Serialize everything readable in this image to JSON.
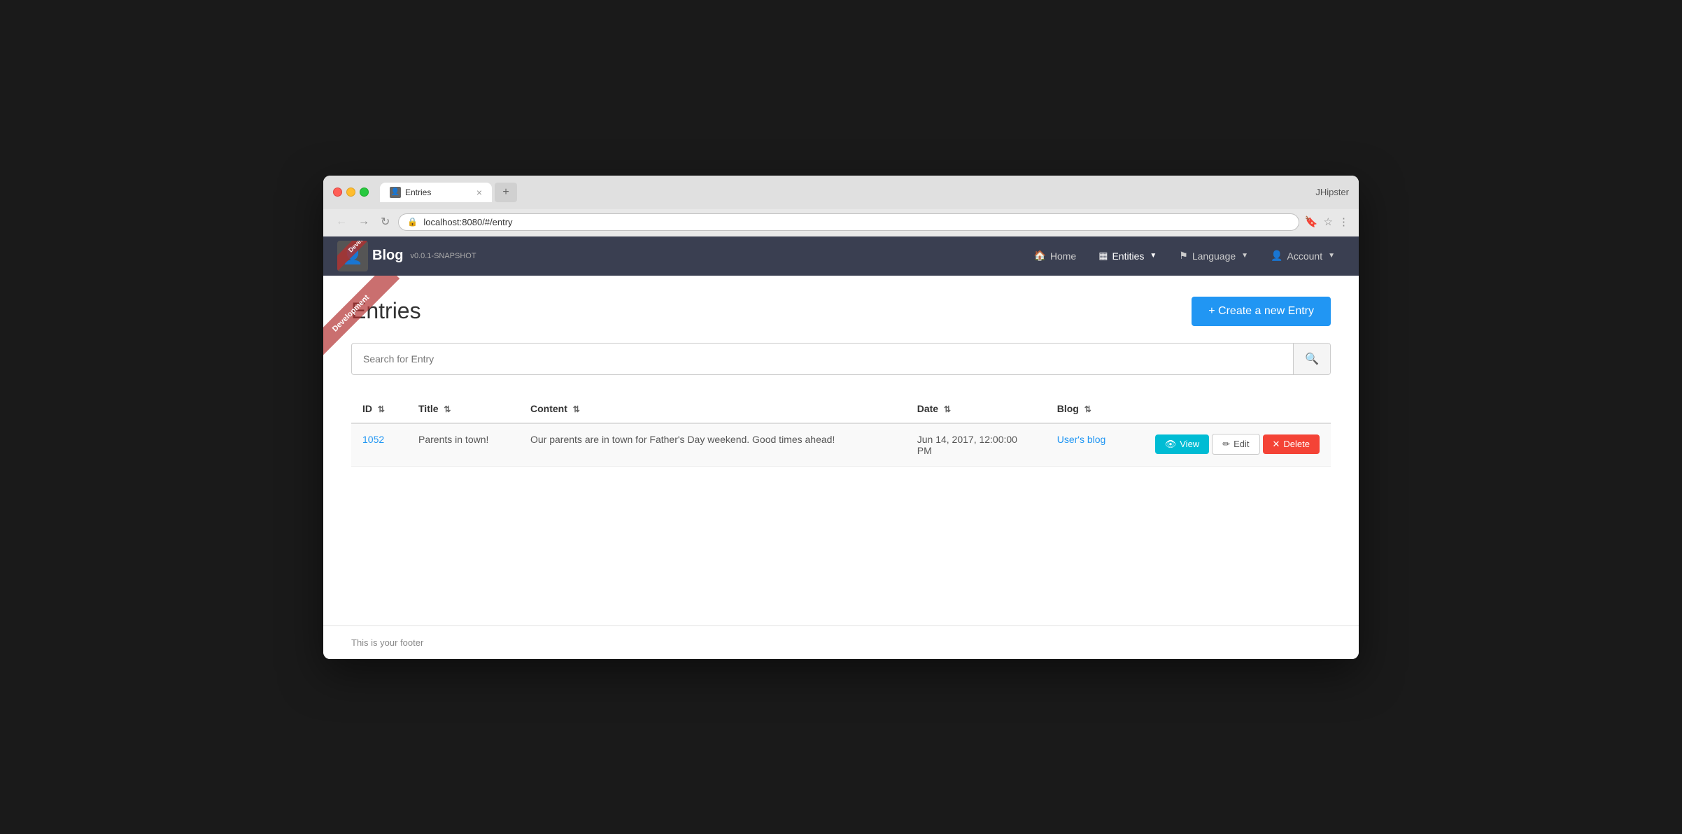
{
  "browser": {
    "tab_title": "Entries",
    "url": "localhost:8080/#/entry",
    "title_right": "JHipster",
    "new_tab_label": "+"
  },
  "navbar": {
    "brand": {
      "name": "Blog",
      "version": "v0.0.1-SNAPSHOT",
      "ribbon": "Development"
    },
    "nav_items": [
      {
        "label": "Home",
        "icon": "🏠",
        "active": false,
        "has_caret": false
      },
      {
        "label": "Entities",
        "icon": "▦",
        "active": true,
        "has_caret": true
      },
      {
        "label": "Language",
        "icon": "⚑",
        "active": false,
        "has_caret": true
      },
      {
        "label": "Account",
        "icon": "👤",
        "active": false,
        "has_caret": true
      }
    ]
  },
  "page": {
    "title": "Entries",
    "ribbon_text": "Development",
    "create_button_label": "+ Create a new Entry",
    "search_placeholder": "Search for Entry"
  },
  "table": {
    "columns": [
      {
        "key": "id",
        "label": "ID",
        "sortable": true
      },
      {
        "key": "title",
        "label": "Title",
        "sortable": true
      },
      {
        "key": "content",
        "label": "Content",
        "sortable": true
      },
      {
        "key": "date",
        "label": "Date",
        "sortable": true
      },
      {
        "key": "blog",
        "label": "Blog",
        "sortable": true
      }
    ],
    "rows": [
      {
        "id": "1052",
        "title": "Parents in town!",
        "content": "Our parents are in town for Father's Day weekend. Good times ahead!",
        "date": "Jun 14, 2017, 12:00:00 PM",
        "blog": "User's blog",
        "actions": {
          "view": "View",
          "edit": "Edit",
          "delete": "Delete"
        }
      }
    ]
  },
  "footer": {
    "text": "This is your footer"
  },
  "sort_icon": "⇅"
}
